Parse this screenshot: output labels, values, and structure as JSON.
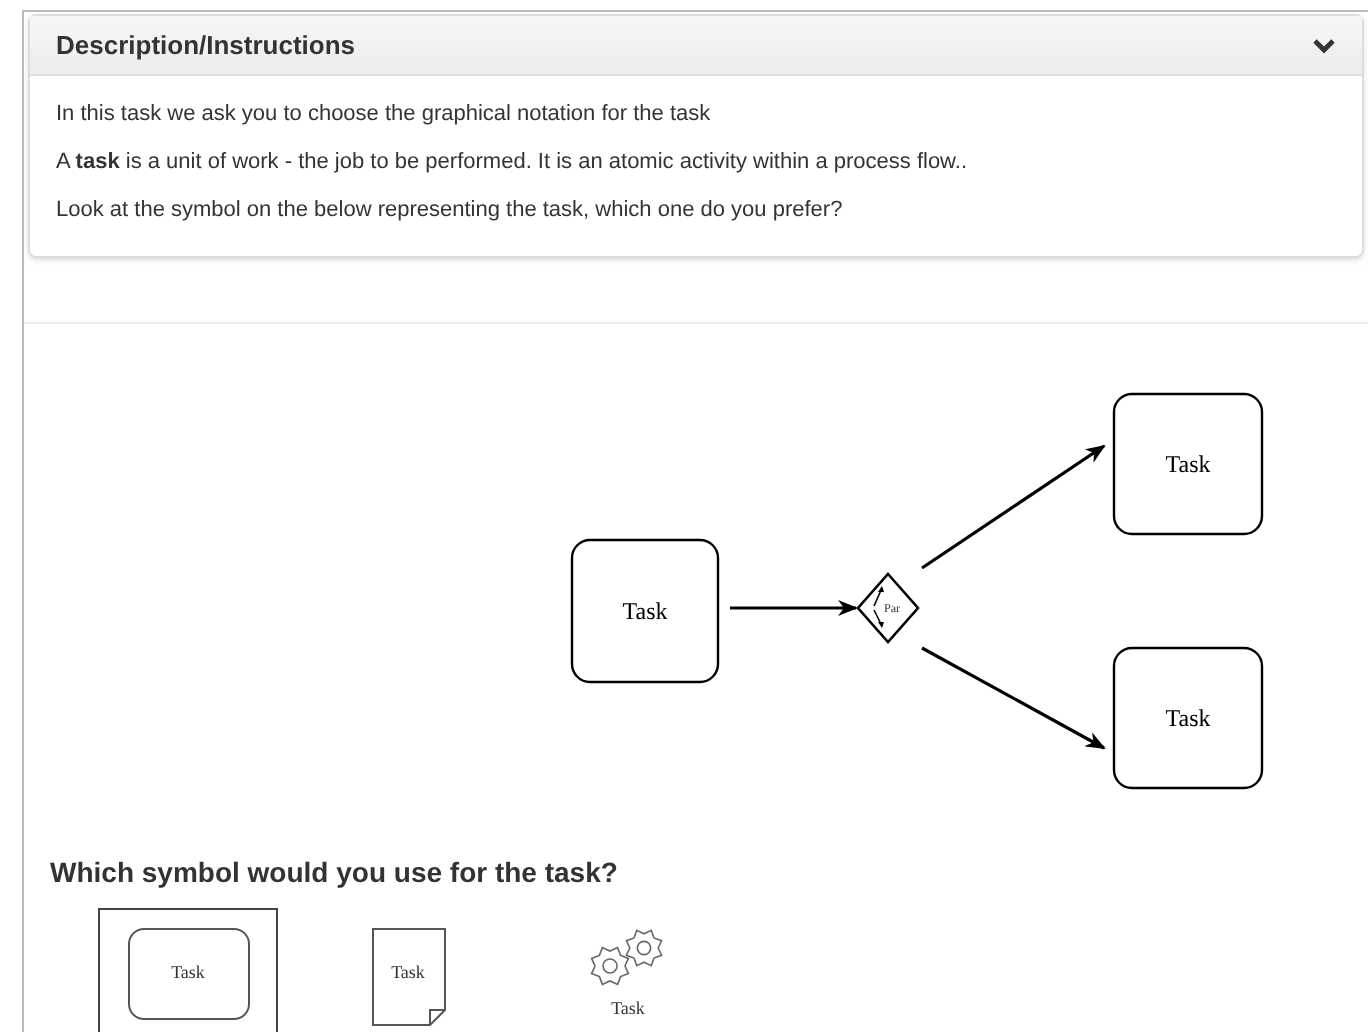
{
  "panel": {
    "title": "Description/Instructions",
    "expanded": true,
    "paragraphs": [
      "In this task we ask you to choose the graphical notation for the task",
      "A **task** is a unit of work - the job to be performed. It is an atomic activity within a process flow..",
      "Look at the symbol on the below representing the task, which one do you prefer?"
    ]
  },
  "diagram": {
    "tasks": [
      {
        "label": "Task"
      },
      {
        "label": "Task"
      },
      {
        "label": "Task"
      }
    ],
    "gateway": {
      "label": "Par"
    }
  },
  "question": "Which symbol would you use for the task?",
  "options": [
    {
      "kind": "rounded",
      "label": "Task",
      "selected": true
    },
    {
      "kind": "page",
      "label": "Task",
      "selected": false
    },
    {
      "kind": "gears",
      "label": "Task",
      "selected": false
    }
  ]
}
